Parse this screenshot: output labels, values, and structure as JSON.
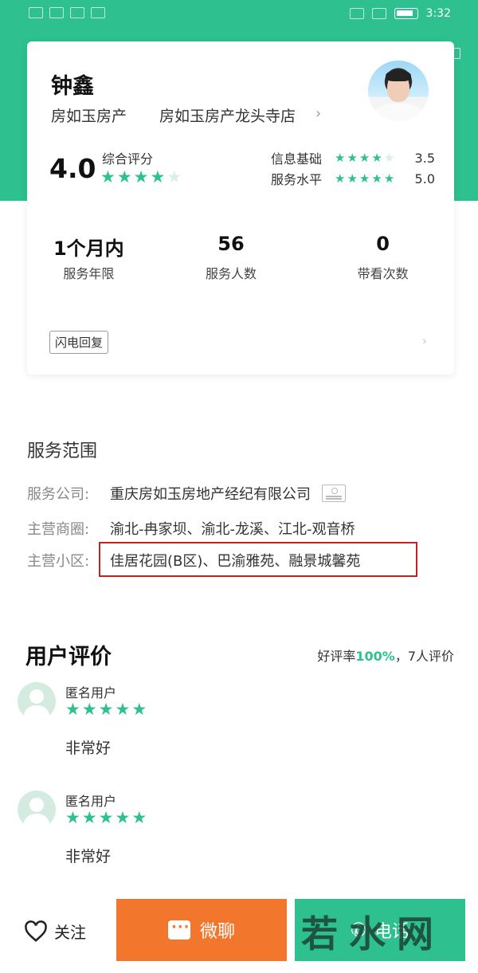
{
  "status_bar": {
    "time": "3:32",
    "battery": ""
  },
  "agent": {
    "name": "钟鑫",
    "company": "房如玉房产",
    "store": "房如玉房产龙头寺店",
    "overall_score": "4.0",
    "overall_label": "综合评分",
    "overall_stars": 4,
    "sub_ratings": [
      {
        "label": "信息基础",
        "stars": 4,
        "score": "3.5"
      },
      {
        "label": "服务水平",
        "stars": 5,
        "score": "5.0"
      }
    ],
    "stats": [
      {
        "value": "1个月内",
        "label": "服务年限"
      },
      {
        "value": "56",
        "label": "服务人数"
      },
      {
        "value": "0",
        "label": "带看次数"
      }
    ],
    "badge": "闪电回复"
  },
  "service_scope": {
    "title": "服务范围",
    "rows": [
      {
        "label": "服务公司:",
        "value": "重庆房如玉房地产经纪有限公司"
      },
      {
        "label": "主营商圈:",
        "value": "渝北-冉家坝、渝北-龙溪、江北-观音桥"
      },
      {
        "label": "主营小区:",
        "value": "佳居花园(B区)、巴渝雅苑、融景城馨苑"
      }
    ]
  },
  "reviews": {
    "title": "用户评价",
    "summary_prefix": "好评率",
    "summary_rate": "100%",
    "summary_suffix": "，7人评价",
    "items": [
      {
        "user": "匿名用户",
        "stars": 5,
        "text": "非常好"
      },
      {
        "user": "匿名用户",
        "stars": 5,
        "text": "非常好"
      }
    ]
  },
  "actions": {
    "follow": "关注",
    "chat": "微聊",
    "call": "电话"
  },
  "watermark": {
    "text": "若水网"
  },
  "colors": {
    "brand_green": "#2ec08f",
    "chat_orange": "#f2772c",
    "highlight_red": "#b5282a"
  }
}
